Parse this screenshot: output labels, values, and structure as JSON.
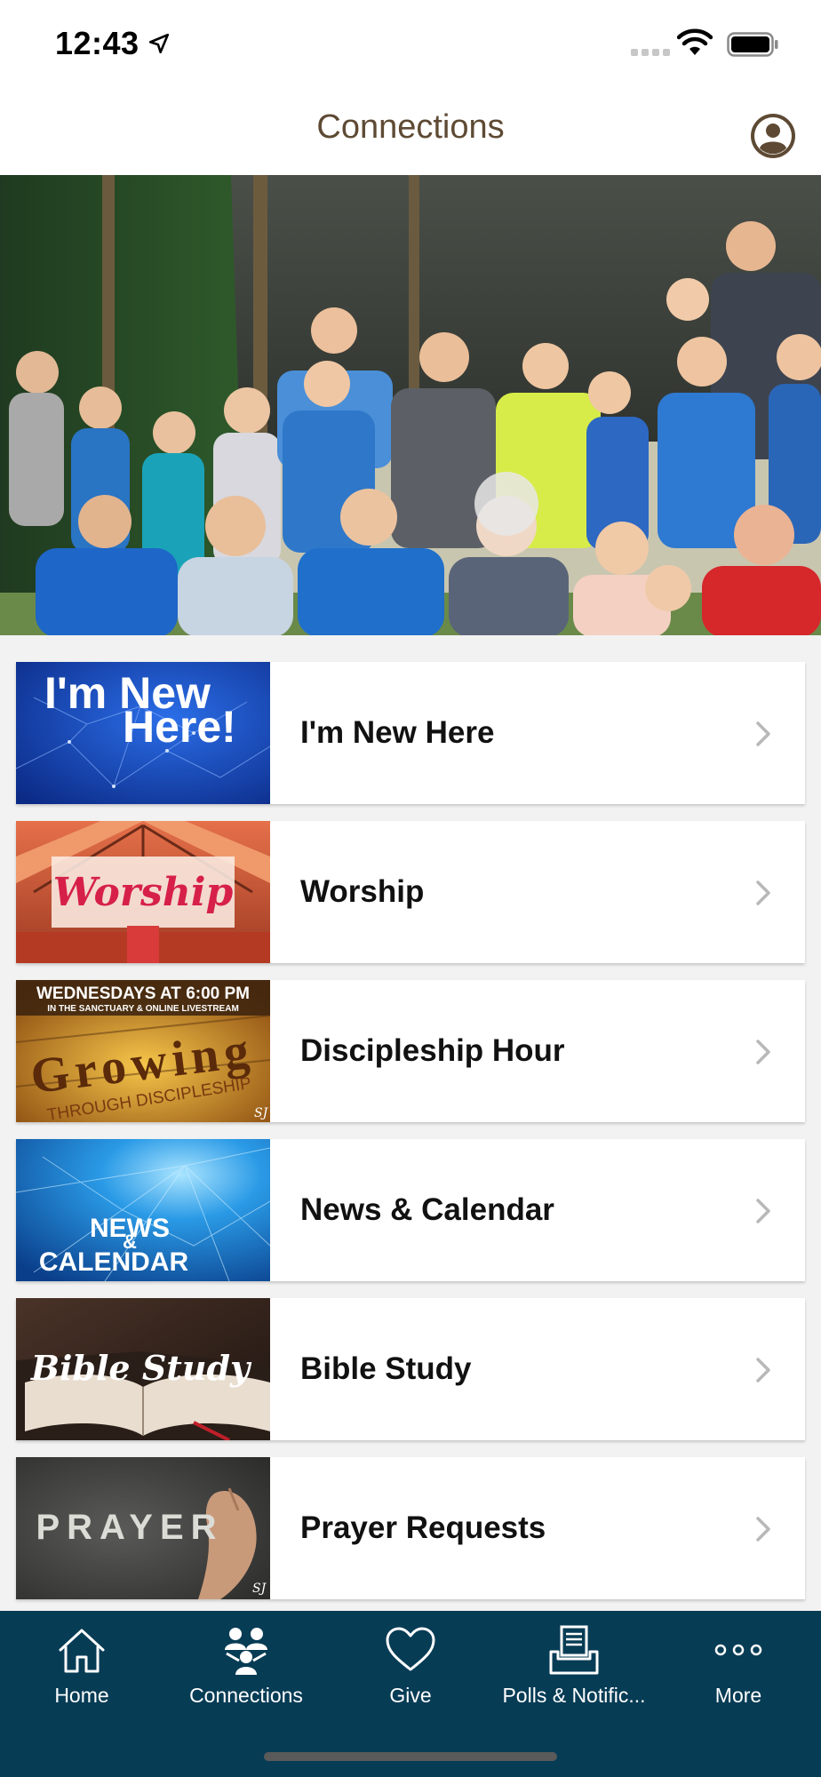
{
  "status_bar": {
    "time": "12:43"
  },
  "nav": {
    "title": "Connections"
  },
  "items": [
    {
      "label": "I'm New Here",
      "thumb_line1": "I'm New",
      "thumb_line2": "Here!"
    },
    {
      "label": "Worship",
      "thumb_text": "Worship"
    },
    {
      "label": "Discipleship Hour",
      "thumb_top": "WEDNESDAYS AT 6:00 PM",
      "thumb_sub": "IN THE SANCTUARY & ONLINE LIVESTREAM",
      "thumb_big": "Growing",
      "thumb_small": "THROUGH DISCIPLESHIP",
      "thumb_mark": "SJ"
    },
    {
      "label": "News & Calendar",
      "thumb_line1": "NEWS",
      "thumb_amp": "&",
      "thumb_line2": "CALENDAR"
    },
    {
      "label": "Bible Study",
      "thumb_text": "Bible Study"
    },
    {
      "label": "Prayer Requests",
      "thumb_text": "PRAYER",
      "thumb_mark": "SJ"
    }
  ],
  "tabs": [
    {
      "label": "Home",
      "icon": "home-icon"
    },
    {
      "label": "Connections",
      "icon": "people-icon"
    },
    {
      "label": "Give",
      "icon": "heart-icon"
    },
    {
      "label": "Polls & Notific...",
      "icon": "inbox-icon"
    },
    {
      "label": "More",
      "icon": "more-icon"
    }
  ],
  "colors": {
    "tab_bar": "#073c55",
    "title": "#5e4a34"
  }
}
